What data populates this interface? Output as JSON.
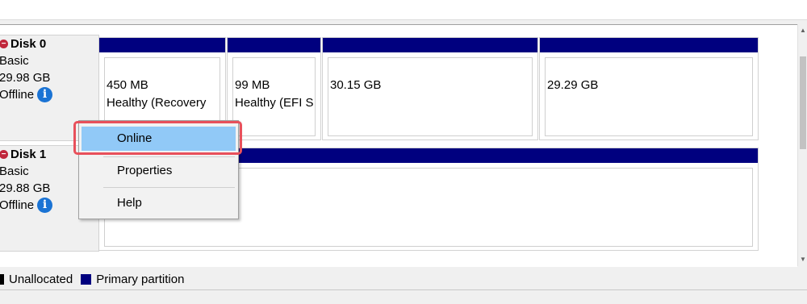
{
  "disks": [
    {
      "name": "Disk 0",
      "type": "Basic",
      "size": "29.98 GB",
      "status": "Offline",
      "partitions": [
        {
          "size": "450 MB",
          "status": "Healthy (Recovery"
        },
        {
          "size": "99 MB",
          "status": "Healthy (EFI S"
        },
        {
          "size": "30.15 GB",
          "status": ""
        },
        {
          "size": "29.29 GB",
          "status": ""
        }
      ]
    },
    {
      "name": "Disk 1",
      "type": "Basic",
      "size": "29.88 GB",
      "status": "Offline"
    }
  ],
  "context_menu": {
    "items": [
      "Online",
      "Properties",
      "Help"
    ],
    "highlighted": "Online"
  },
  "legend": {
    "unallocated": "Unallocated",
    "primary": "Primary partition"
  },
  "colors": {
    "partition_bar": "#00007f",
    "menu_hover": "#91c9f7",
    "highlight_box": "#e8505b",
    "error_icon": "#c0263b",
    "info_icon": "#1a73d4"
  }
}
